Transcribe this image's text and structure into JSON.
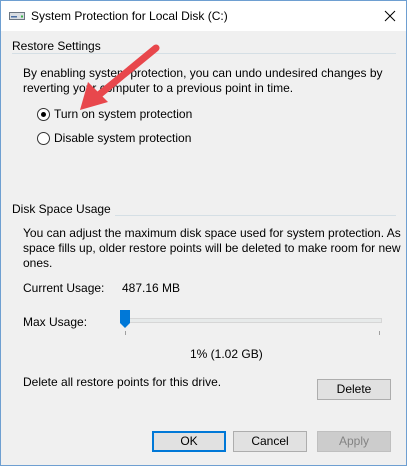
{
  "window": {
    "title": "System Protection for Local Disk (C:)",
    "icon": "drive-icon",
    "close_icon": "close-icon"
  },
  "restore_settings": {
    "heading": "Restore Settings",
    "description_line1": "By enabling system protection, you can undo undesired changes by",
    "description_line2": "reverting your computer to a previous point in time.",
    "options": [
      {
        "label": "Turn on system protection",
        "selected": true
      },
      {
        "label": "Disable system protection",
        "selected": false
      }
    ]
  },
  "disk_space": {
    "heading": "Disk Space Usage",
    "description_line1": "You can adjust the maximum disk space used for system protection. As",
    "description_line2": "space fills up, older restore points will be deleted to make room for new",
    "description_line3": "ones.",
    "current_usage_label": "Current Usage:",
    "current_usage_value": "487.16 MB",
    "max_usage_label": "Max Usage:",
    "max_usage_percent": 1,
    "max_usage_readout": "1% (1.02 GB)"
  },
  "delete_section": {
    "text": "Delete all restore points for this drive.",
    "button": "Delete"
  },
  "buttons": {
    "ok": "OK",
    "cancel": "Cancel",
    "apply": "Apply"
  },
  "colors": {
    "accent": "#0078d7",
    "annotation_arrow": "#e8474c"
  }
}
